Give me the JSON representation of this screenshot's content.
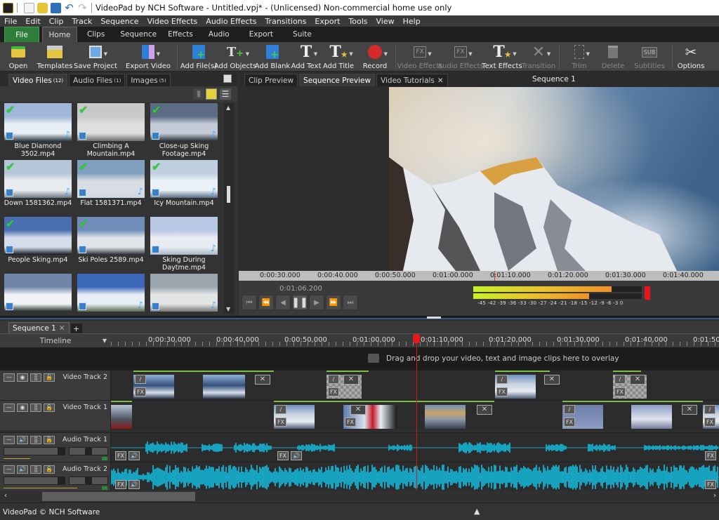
{
  "window": {
    "title": "VideoPad by NCH Software - Untitled.vpj* - (Unlicensed) Non-commercial home use only",
    "quick_access": [
      "app-icon",
      "new-icon",
      "open-icon",
      "save-icon",
      "undo-icon",
      "redo-icon"
    ]
  },
  "menubar": [
    "File",
    "Edit",
    "Clip",
    "Track",
    "Sequence",
    "Video Effects",
    "Audio Effects",
    "Transitions",
    "Export",
    "Tools",
    "View",
    "Help"
  ],
  "ribbon_tabs": [
    "File",
    "Home",
    "Clips",
    "Sequence",
    "Effects",
    "Audio",
    "Export",
    "Suite"
  ],
  "ribbon_active": "Home",
  "toolbar": {
    "open": "Open",
    "templates": "Templates",
    "save_project": "Save Project",
    "export_video": "Export Video",
    "add_files": "Add File(s)",
    "add_objects": "Add Objects",
    "add_blank": "Add Blank",
    "add_text": "Add Text",
    "add_title": "Add Title",
    "record": "Record",
    "video_effects": "Video Effects",
    "audio_effects": "Audio Effects",
    "text_effects": "Text Effects",
    "transition": "Transition",
    "trim": "Trim",
    "delete": "Delete",
    "subtitles": "Subtitles",
    "options": "Options"
  },
  "media_panel": {
    "tabs": [
      {
        "label": "Video Files",
        "count": "(12)"
      },
      {
        "label": "Audio Files",
        "count": "(1)"
      },
      {
        "label": "Images",
        "count": "(5)"
      }
    ],
    "files": [
      {
        "name": "Blue Diamond 3502.mp4",
        "checked": true,
        "audio": true
      },
      {
        "name": "Climbing A Mountain.mp4",
        "checked": true,
        "audio": false
      },
      {
        "name": "Close-up Sking Footage.mp4",
        "checked": true,
        "audio": true
      },
      {
        "name": "Down 1581362.mp4",
        "checked": true,
        "audio": true
      },
      {
        "name": "Flat 1581371.mp4",
        "checked": true,
        "audio": true
      },
      {
        "name": "Icy Mountain.mp4",
        "checked": true,
        "audio": true
      },
      {
        "name": "People Sking.mp4",
        "checked": true,
        "audio": false
      },
      {
        "name": "Ski Poles 2589.mp4",
        "checked": true,
        "audio": false
      },
      {
        "name": "Sking During Daytme.mp4",
        "checked": false,
        "audio": true
      },
      {
        "name": "",
        "checked": false,
        "audio": false
      },
      {
        "name": "",
        "checked": false,
        "audio": true
      },
      {
        "name": "",
        "checked": false,
        "audio": true
      }
    ]
  },
  "preview": {
    "tabs": [
      "Clip Preview",
      "Sequence Preview",
      "Video Tutorials"
    ],
    "active_tab": "Sequence Preview",
    "title": "Sequence 1",
    "ruler": [
      "0:00:30.000",
      "0:00:40.000",
      "0:00:50.000",
      "0:01:00.000",
      "0:01:10.000",
      "0:01:20.000",
      "0:01:30.000",
      "0:01:40.000"
    ],
    "current_time": "0:01:06.200",
    "meter_scale": "-45 -42 -39 -36 -33 -30 -27 -24 -21 -18 -15 -12 -9 -6 -3 0",
    "meter_levels_db": [
      -8,
      -14
    ]
  },
  "timeline": {
    "sequence_tab": "Sequence 1",
    "header_label": "Timeline",
    "ruler": [
      "0:00:30,000",
      "0:00:40,000",
      "0:00:50,000",
      "0:01:00,000",
      "0:01:10,000",
      "0:01:20,000",
      "0:01:30,000",
      "0:01:40,000",
      "0:01:50"
    ],
    "overlay_hint": "Drag and drop your video, text and image clips here to overlay",
    "tracks": [
      "Video Track 2",
      "Video Track 1",
      "Audio Track 1",
      "Audio Track 2"
    ],
    "playhead_time": "0:01:06.200"
  },
  "status": "VideoPad © NCH Software",
  "colors": {
    "accent_green": "#2e7d3a",
    "waveform": "#17a3bf",
    "playhead": "#d41a1a",
    "clip_bar": "#7cc144"
  }
}
